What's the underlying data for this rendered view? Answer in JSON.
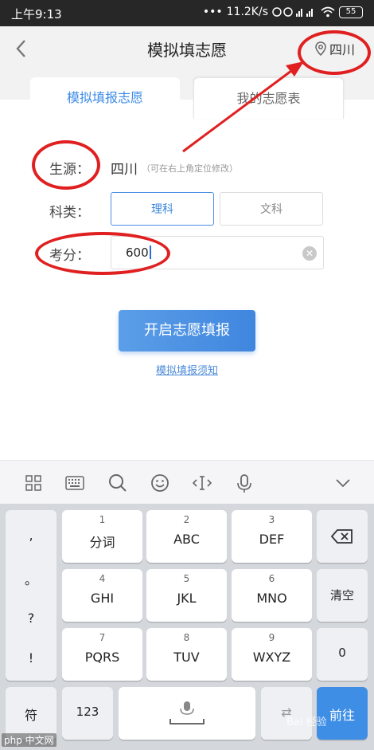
{
  "status": {
    "time": "上午9:13",
    "network_speed": "11.2K/s",
    "battery": "55"
  },
  "header": {
    "title": "模拟填志愿",
    "location": "四川"
  },
  "tabs": {
    "active": "模拟填报志愿",
    "inactive": "我的志愿表"
  },
  "form": {
    "source_label": "生源：",
    "source_value": "四川",
    "source_hint": "（可在右上角定位修改）",
    "subject_label": "科类：",
    "subject_options": [
      "理科",
      "文科"
    ],
    "subject_selected": "理科",
    "score_label": "考分：",
    "score_value": "600"
  },
  "actions": {
    "start_button": "开启志愿填报",
    "rules_link": "模拟填报须知"
  },
  "keyboard": {
    "toolbar_icons": [
      "grid-icon",
      "keyboard-icon",
      "search-icon",
      "emoji-icon",
      "cursor-icon",
      "microphone-icon",
      "chevron-down-icon"
    ],
    "left_column": [
      ",",
      "。",
      "?",
      "!"
    ],
    "keys": [
      {
        "num": "1",
        "letters": "分词"
      },
      {
        "num": "2",
        "letters": "ABC"
      },
      {
        "num": "3",
        "letters": "DEF"
      },
      {
        "num": "4",
        "letters": "GHI"
      },
      {
        "num": "5",
        "letters": "JKL"
      },
      {
        "num": "6",
        "letters": "MNO"
      },
      {
        "num": "7",
        "letters": "PQRS"
      },
      {
        "num": "8",
        "letters": "TUV"
      },
      {
        "num": "9",
        "letters": "WXYZ"
      }
    ],
    "clear_key": "清空",
    "zero_key": "0",
    "symbol_key": "符",
    "num_key": "123",
    "enter_key": "前往"
  },
  "watermarks": {
    "bottom_left": "php 中文网",
    "bottom_right": "Bai 经验"
  },
  "colors": {
    "accent": "#3d8be6",
    "annotation": "#e02020",
    "status_bar": "#272727"
  }
}
